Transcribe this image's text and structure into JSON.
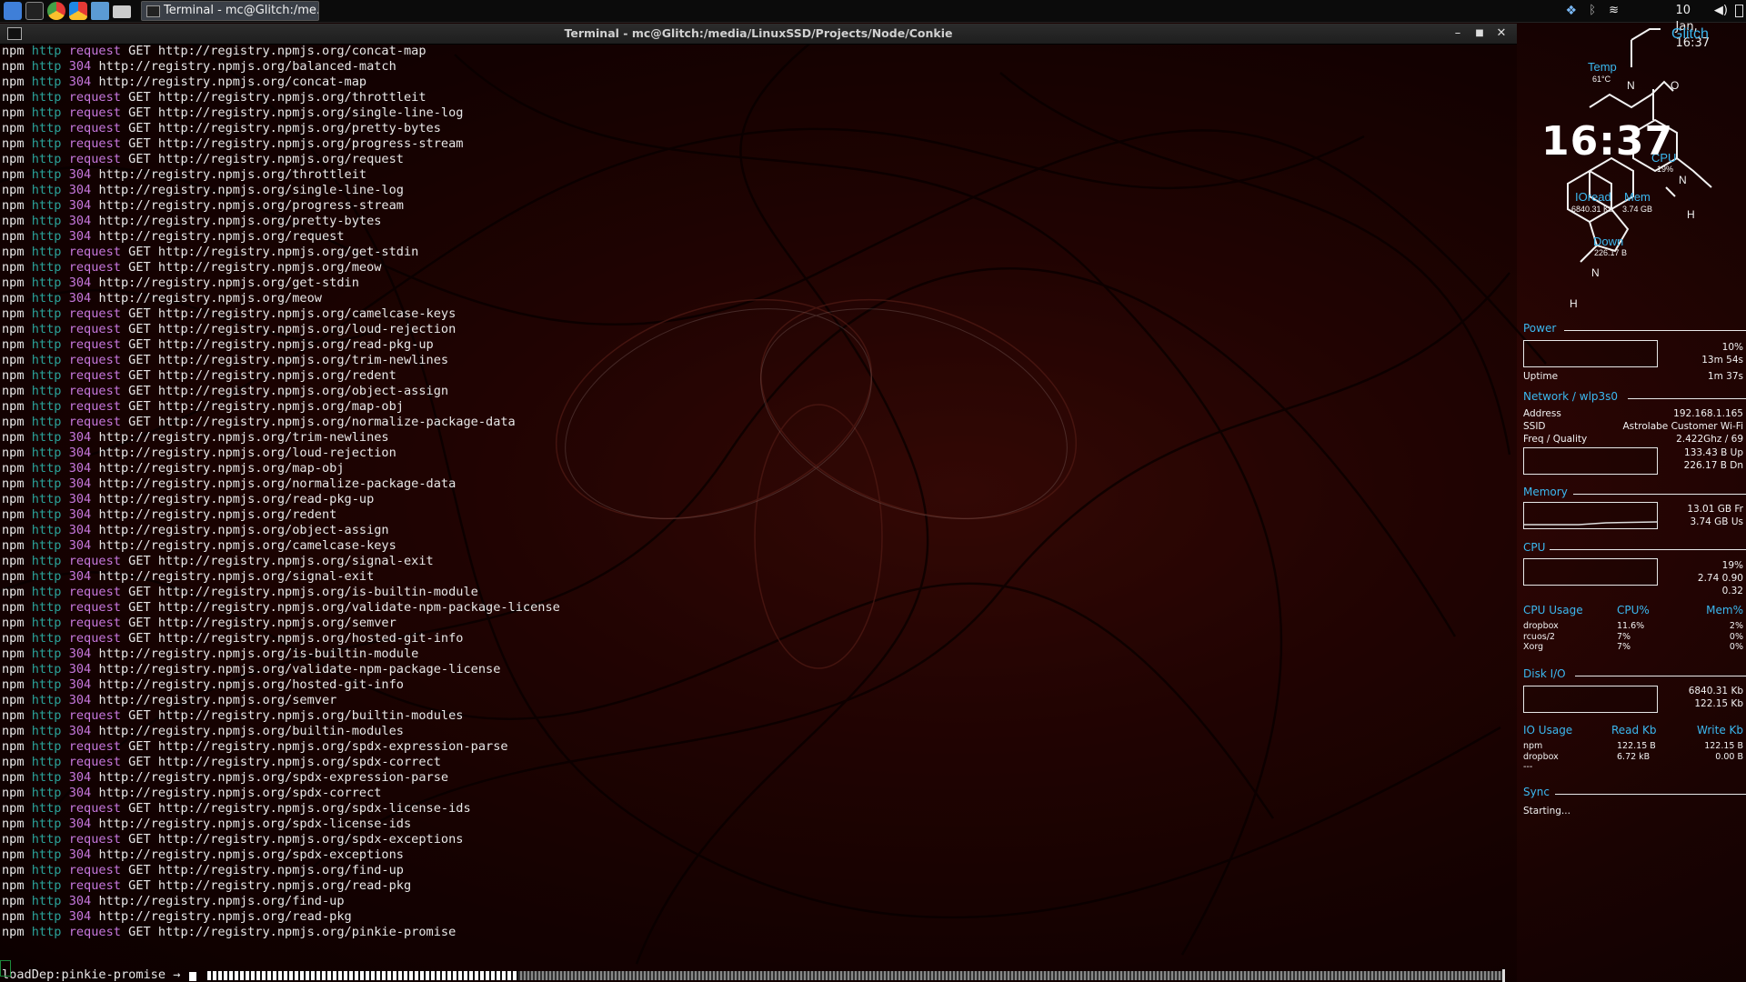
{
  "colors": {
    "accent": "#3bb8f0",
    "http": "#2aa198",
    "request": "#c678dd",
    "background": "#2e0604"
  },
  "top_panel": {
    "launchers": [
      "menu-icon",
      "terminal-icon",
      "chrome-icon",
      "chrome-alt-icon",
      "folder-icon",
      "drive-icon"
    ],
    "task_label": "Terminal - mc@Glitch:/me...",
    "datetime": "10 Jan, 16:37"
  },
  "terminal": {
    "title": "Terminal - mc@Glitch:/media/LinuxSSD/Projects/Node/Conkie",
    "lines": [
      [
        "npm",
        "http",
        "request",
        "GET http://registry.npmjs.org/concat-map"
      ],
      [
        "npm",
        "http",
        "304",
        "http://registry.npmjs.org/balanced-match"
      ],
      [
        "npm",
        "http",
        "304",
        "http://registry.npmjs.org/concat-map"
      ],
      [
        "npm",
        "http",
        "request",
        "GET http://registry.npmjs.org/throttleit"
      ],
      [
        "npm",
        "http",
        "request",
        "GET http://registry.npmjs.org/single-line-log"
      ],
      [
        "npm",
        "http",
        "request",
        "GET http://registry.npmjs.org/pretty-bytes"
      ],
      [
        "npm",
        "http",
        "request",
        "GET http://registry.npmjs.org/progress-stream"
      ],
      [
        "npm",
        "http",
        "request",
        "GET http://registry.npmjs.org/request"
      ],
      [
        "npm",
        "http",
        "304",
        "http://registry.npmjs.org/throttleit"
      ],
      [
        "npm",
        "http",
        "304",
        "http://registry.npmjs.org/single-line-log"
      ],
      [
        "npm",
        "http",
        "304",
        "http://registry.npmjs.org/progress-stream"
      ],
      [
        "npm",
        "http",
        "304",
        "http://registry.npmjs.org/pretty-bytes"
      ],
      [
        "npm",
        "http",
        "304",
        "http://registry.npmjs.org/request"
      ],
      [
        "npm",
        "http",
        "request",
        "GET http://registry.npmjs.org/get-stdin"
      ],
      [
        "npm",
        "http",
        "request",
        "GET http://registry.npmjs.org/meow"
      ],
      [
        "npm",
        "http",
        "304",
        "http://registry.npmjs.org/get-stdin"
      ],
      [
        "npm",
        "http",
        "304",
        "http://registry.npmjs.org/meow"
      ],
      [
        "npm",
        "http",
        "request",
        "GET http://registry.npmjs.org/camelcase-keys"
      ],
      [
        "npm",
        "http",
        "request",
        "GET http://registry.npmjs.org/loud-rejection"
      ],
      [
        "npm",
        "http",
        "request",
        "GET http://registry.npmjs.org/read-pkg-up"
      ],
      [
        "npm",
        "http",
        "request",
        "GET http://registry.npmjs.org/trim-newlines"
      ],
      [
        "npm",
        "http",
        "request",
        "GET http://registry.npmjs.org/redent"
      ],
      [
        "npm",
        "http",
        "request",
        "GET http://registry.npmjs.org/object-assign"
      ],
      [
        "npm",
        "http",
        "request",
        "GET http://registry.npmjs.org/map-obj"
      ],
      [
        "npm",
        "http",
        "request",
        "GET http://registry.npmjs.org/normalize-package-data"
      ],
      [
        "npm",
        "http",
        "304",
        "http://registry.npmjs.org/trim-newlines"
      ],
      [
        "npm",
        "http",
        "304",
        "http://registry.npmjs.org/loud-rejection"
      ],
      [
        "npm",
        "http",
        "304",
        "http://registry.npmjs.org/map-obj"
      ],
      [
        "npm",
        "http",
        "304",
        "http://registry.npmjs.org/normalize-package-data"
      ],
      [
        "npm",
        "http",
        "304",
        "http://registry.npmjs.org/read-pkg-up"
      ],
      [
        "npm",
        "http",
        "304",
        "http://registry.npmjs.org/redent"
      ],
      [
        "npm",
        "http",
        "304",
        "http://registry.npmjs.org/object-assign"
      ],
      [
        "npm",
        "http",
        "304",
        "http://registry.npmjs.org/camelcase-keys"
      ],
      [
        "npm",
        "http",
        "request",
        "GET http://registry.npmjs.org/signal-exit"
      ],
      [
        "npm",
        "http",
        "304",
        "http://registry.npmjs.org/signal-exit"
      ],
      [
        "npm",
        "http",
        "request",
        "GET http://registry.npmjs.org/is-builtin-module"
      ],
      [
        "npm",
        "http",
        "request",
        "GET http://registry.npmjs.org/validate-npm-package-license"
      ],
      [
        "npm",
        "http",
        "request",
        "GET http://registry.npmjs.org/semver"
      ],
      [
        "npm",
        "http",
        "request",
        "GET http://registry.npmjs.org/hosted-git-info"
      ],
      [
        "npm",
        "http",
        "304",
        "http://registry.npmjs.org/is-builtin-module"
      ],
      [
        "npm",
        "http",
        "304",
        "http://registry.npmjs.org/validate-npm-package-license"
      ],
      [
        "npm",
        "http",
        "304",
        "http://registry.npmjs.org/hosted-git-info"
      ],
      [
        "npm",
        "http",
        "304",
        "http://registry.npmjs.org/semver"
      ],
      [
        "npm",
        "http",
        "request",
        "GET http://registry.npmjs.org/builtin-modules"
      ],
      [
        "npm",
        "http",
        "304",
        "http://registry.npmjs.org/builtin-modules"
      ],
      [
        "npm",
        "http",
        "request",
        "GET http://registry.npmjs.org/spdx-expression-parse"
      ],
      [
        "npm",
        "http",
        "request",
        "GET http://registry.npmjs.org/spdx-correct"
      ],
      [
        "npm",
        "http",
        "304",
        "http://registry.npmjs.org/spdx-expression-parse"
      ],
      [
        "npm",
        "http",
        "304",
        "http://registry.npmjs.org/spdx-correct"
      ],
      [
        "npm",
        "http",
        "request",
        "GET http://registry.npmjs.org/spdx-license-ids"
      ],
      [
        "npm",
        "http",
        "304",
        "http://registry.npmjs.org/spdx-license-ids"
      ],
      [
        "npm",
        "http",
        "request",
        "GET http://registry.npmjs.org/spdx-exceptions"
      ],
      [
        "npm",
        "http",
        "304",
        "http://registry.npmjs.org/spdx-exceptions"
      ],
      [
        "npm",
        "http",
        "request",
        "GET http://registry.npmjs.org/find-up"
      ],
      [
        "npm",
        "http",
        "request",
        "GET http://registry.npmjs.org/read-pkg"
      ],
      [
        "npm",
        "http",
        "304",
        "http://registry.npmjs.org/find-up"
      ],
      [
        "npm",
        "http",
        "304",
        "http://registry.npmjs.org/read-pkg"
      ],
      [
        "npm",
        "http",
        "request",
        "GET http://registry.npmjs.org/pinkie-promise"
      ]
    ],
    "progress_label": "loadDep:pinkie-promise →",
    "progress_fraction": 0.24
  },
  "conky": {
    "hostname": "Glitch",
    "temp_label": "Temp",
    "temp_value": "61°C",
    "clock": "16:37",
    "cpu_label": "CPU",
    "cpu_value": "19%",
    "ioread_label": "IOread",
    "ioread_value": "6840.31 Kb",
    "mem_label": "Mem",
    "mem_value": "3.74 GB",
    "down_label": "Down",
    "down_value": "226.17 B",
    "atom_n": "N",
    "atom_o": "O",
    "atom_h": "H",
    "power": {
      "title": "Power",
      "percent": "10%",
      "remaining": "13m 54s",
      "uptime_label": "Uptime",
      "uptime": "1m 37s"
    },
    "network": {
      "title": "Network / wlp3s0",
      "address_label": "Address",
      "address": "192.168.1.165",
      "ssid_label": "SSID",
      "ssid": "Astrolabe Customer Wi-Fi",
      "freq_label": "Freq / Quality",
      "freq": "2.422Ghz / 69",
      "up": "133.43 B Up",
      "down": "226.17 B Dn"
    },
    "memory": {
      "title": "Memory",
      "free": "13.01 GB Fr",
      "used": "3.74 GB Us"
    },
    "cpu": {
      "title": "CPU",
      "percent": "19%",
      "load1": "2.74 0.90",
      "load2": "0.32"
    },
    "cpu_usage": {
      "headers": [
        "CPU Usage",
        "CPU%",
        "Mem%"
      ],
      "rows": [
        [
          "dropbox",
          "11.6%",
          "2%"
        ],
        [
          "rcuos/2",
          "7%",
          "0%"
        ],
        [
          "Xorg",
          "7%",
          "0%"
        ]
      ]
    },
    "disk": {
      "title": "Disk I/O",
      "read": "6840.31 Kb",
      "write": "122.15 Kb"
    },
    "io_usage": {
      "headers": [
        "IO Usage",
        "Read Kb",
        "Write Kb"
      ],
      "rows": [
        [
          "npm",
          "122.15 B",
          "122.15 B"
        ],
        [
          "dropbox",
          "6.72 kB",
          "0.00 B"
        ],
        [
          "---",
          "",
          ""
        ]
      ]
    },
    "sync": {
      "title": "Sync",
      "status": "Starting..."
    }
  }
}
